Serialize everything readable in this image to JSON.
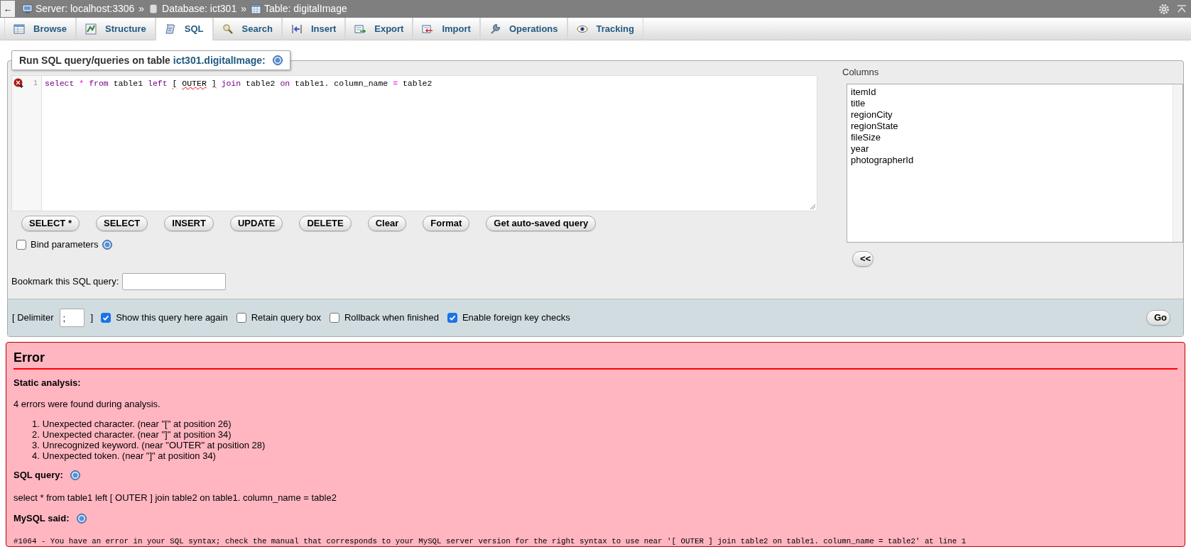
{
  "top_bar": {
    "back": "←",
    "breadcrumbs": [
      {
        "label": "Server: localhost:3306"
      },
      {
        "label": "Database: ict301"
      },
      {
        "label": "Table: digitalImage"
      }
    ],
    "separator": "»"
  },
  "tabs": [
    {
      "label": "Browse",
      "selected": false
    },
    {
      "label": "Structure",
      "selected": false
    },
    {
      "label": "SQL",
      "selected": true
    },
    {
      "label": "Search",
      "selected": false
    },
    {
      "label": "Insert",
      "selected": false
    },
    {
      "label": "Export",
      "selected": false
    },
    {
      "label": "Import",
      "selected": false
    },
    {
      "label": "Operations",
      "selected": false
    },
    {
      "label": "Tracking",
      "selected": false
    }
  ],
  "query_panel": {
    "legend": "Run SQL query/queries on table ",
    "legend_link": "ict301.digitalImage:",
    "editor": {
      "line_number": "1",
      "has_error": true,
      "tokens": [
        {
          "text": "select",
          "kind": "keyword"
        },
        {
          "text": "*",
          "kind": "operator"
        },
        {
          "text": "from",
          "kind": "keyword"
        },
        {
          "text": "table1",
          "kind": "plain"
        },
        {
          "text": "left",
          "kind": "keyword"
        },
        {
          "text": "[",
          "kind": "error"
        },
        {
          "text": "OUTER",
          "kind": "error"
        },
        {
          "text": "]",
          "kind": "error"
        },
        {
          "text": "join",
          "kind": "keyword"
        },
        {
          "text": "table2",
          "kind": "plain"
        },
        {
          "text": "on",
          "kind": "keyword"
        },
        {
          "text": "table1.",
          "kind": "plain"
        },
        {
          "text": "column_name",
          "kind": "plain"
        },
        {
          "text": "=",
          "kind": "operator"
        },
        {
          "text": "table2",
          "kind": "plain"
        }
      ]
    },
    "buttons": [
      "SELECT *",
      "SELECT",
      "INSERT",
      "UPDATE",
      "DELETE",
      "Clear",
      "Format",
      "Get auto-saved query"
    ],
    "bind_parameters": {
      "label": "Bind parameters",
      "checked": false
    },
    "bookmark": {
      "label": "Bookmark this SQL query:"
    },
    "columns": {
      "label": "Columns",
      "items": [
        "itemId",
        "title",
        "regionCity",
        "regionState",
        "fileSize",
        "year",
        "photographerId"
      ],
      "insert_button": "<<"
    },
    "options": {
      "delimiter_open": "[ Delimiter",
      "delimiter_value": ";",
      "delimiter_close": "]",
      "checkboxes": [
        {
          "label": "Show this query here again",
          "checked": true
        },
        {
          "label": "Retain query box",
          "checked": false
        },
        {
          "label": "Rollback when finished",
          "checked": false
        },
        {
          "label": "Enable foreign key checks",
          "checked": true
        }
      ],
      "go": "Go"
    }
  },
  "error": {
    "title": "Error",
    "static_heading": "Static analysis:",
    "summary": "4 errors were found during analysis.",
    "errors": [
      {
        "number": "1.",
        "text": "Unexpected character. (near \"[\" at position 26)"
      },
      {
        "number": "2.",
        "text": "Unexpected character. (near \"]\" at position 34)"
      },
      {
        "number": "3.",
        "text": "Unrecognized keyword. (near \"OUTER\" at position 28)"
      },
      {
        "number": "4.",
        "text": "Unexpected token. (near \"]\" at position 34)"
      }
    ],
    "sql_heading": "SQL query:",
    "sql": "select * from table1 left [ OUTER ] join table2 on table1. column_name = table2",
    "mysql_heading": "MySQL said:",
    "mysql_message": "#1064 - You have an error in your SQL syntax; check the manual that corresponds to your MySQL server version for the right syntax to use near '[ OUTER ] join table2 on table1. column_name = table2' at line 1"
  }
}
